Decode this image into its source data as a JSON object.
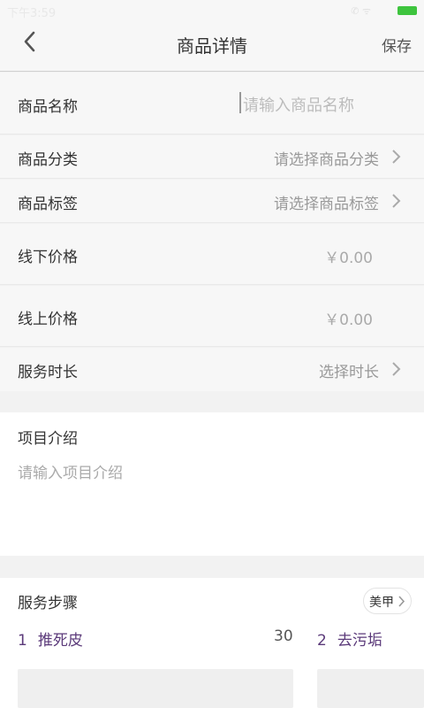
{
  "status_bar": {
    "time": "下午3:59"
  },
  "header": {
    "title": "商品详情",
    "save_label": "保存"
  },
  "form": {
    "name": {
      "label": "商品名称",
      "placeholder": "请输入商品名称"
    },
    "category": {
      "label": "商品分类",
      "value": "请选择商品分类"
    },
    "tag": {
      "label": "商品标签",
      "value": "请选择商品标签"
    },
    "offline_price": {
      "label": "线下价格",
      "value": "￥0.00"
    },
    "online_price": {
      "label": "线上价格",
      "value": "￥0.00"
    },
    "duration": {
      "label": "服务时长",
      "value": "选择时长"
    }
  },
  "intro": {
    "label": "项目介绍",
    "placeholder": "请输入项目介绍"
  },
  "steps": {
    "label": "服务步骤",
    "tag_button": "美甲",
    "items": [
      {
        "num": "1",
        "name": "推死皮",
        "count": "30"
      },
      {
        "num": "2",
        "name": "去污垢"
      }
    ]
  },
  "colors": {
    "accent": "#5b3a7a",
    "battery": "#3ec43e",
    "background": "#f2f2f2"
  },
  "icons": [
    "back-arrow-icon",
    "chevron-right-icon",
    "battery-icon",
    "wifi-icon"
  ]
}
